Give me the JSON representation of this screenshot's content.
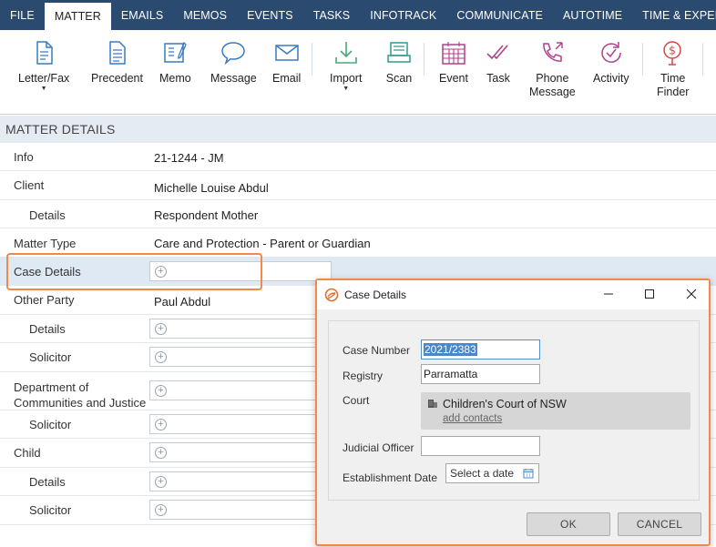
{
  "menu": {
    "tabs": [
      "FILE",
      "MATTER",
      "EMAILS",
      "MEMOS",
      "EVENTS",
      "TASKS",
      "INFOTRACK",
      "COMMUNICATE",
      "AUTOTIME",
      "TIME & EXPENSES"
    ],
    "active": "MATTER"
  },
  "ribbon": {
    "letter_fax": "Letter/Fax",
    "precedent": "Precedent",
    "memo": "Memo",
    "message": "Message",
    "email": "Email",
    "import": "Import",
    "scan": "Scan",
    "event": "Event",
    "task": "Task",
    "phone_message_1": "Phone",
    "phone_message_2": "Message",
    "activity": "Activity",
    "time_finder_1": "Time",
    "time_finder_2": "Finder",
    "icon_color": "#3a7bbf",
    "event_icon_color": "#b0408a"
  },
  "matter_details": {
    "header": "MATTER DETAILS",
    "info_label": "Info",
    "info_value": "21-1244 - JM",
    "client_label": "Client",
    "client_value": "Michelle Louise Abdul",
    "client_details_label": "Details",
    "client_details_value": "Respondent Mother",
    "matter_type_label": "Matter Type",
    "matter_type_value": "Care and Protection - Parent or Guardian",
    "case_details_label": "Case Details",
    "other_party_label": "Other Party",
    "other_party_value": "Paul Abdul",
    "other_party_details_label": "Details",
    "other_party_solicitor_label": "Solicitor",
    "dcj_label_1": "Department of",
    "dcj_label_2": "Communities and Justice",
    "dcj_solicitor_label": "Solicitor",
    "child_label": "Child",
    "child_details_label": "Details",
    "child_solicitor_label": "Solicitor",
    "plus_symbol": "+"
  },
  "dialog": {
    "title": "Case Details",
    "minimize": "—",
    "maximize": "☐",
    "close": "✕",
    "case_number_label": "Case Number",
    "case_number_value": "2021/2383",
    "registry_label": "Registry",
    "registry_value": "Parramatta",
    "court_label": "Court",
    "court_value": "Children's Court of NSW",
    "add_contacts": "add contacts",
    "judicial_officer_label": "Judicial Officer",
    "judicial_officer_value": "",
    "establishment_date_label": "Establishment Date",
    "establishment_date_placeholder": "Select a date",
    "ok": "OK",
    "cancel": "CANCEL",
    "highlight_color": "#f08a4b"
  }
}
